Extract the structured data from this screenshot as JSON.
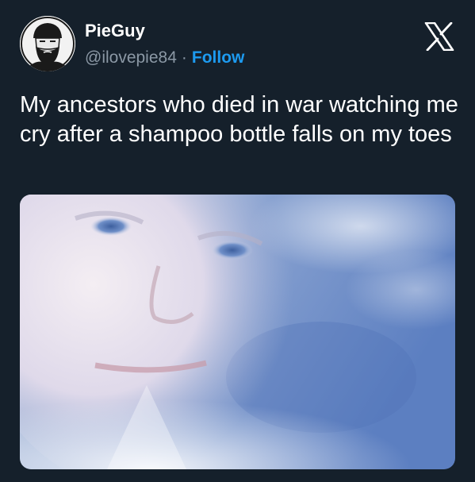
{
  "tweet": {
    "display_name": "PieGuy",
    "handle": "@ilovepie84",
    "separator": "·",
    "follow_label": "Follow",
    "text": "My ancestors who died in war watching me cry after a shampoo bottle falls on my toes",
    "avatar_icon": "profile-avatar",
    "brand_icon": "x-logo-icon",
    "media_description_icon": "meme-image"
  },
  "colors": {
    "background": "#15202b",
    "text_primary": "#ffffff",
    "text_secondary": "#8b98a5",
    "accent": "#1d9bf0"
  }
}
